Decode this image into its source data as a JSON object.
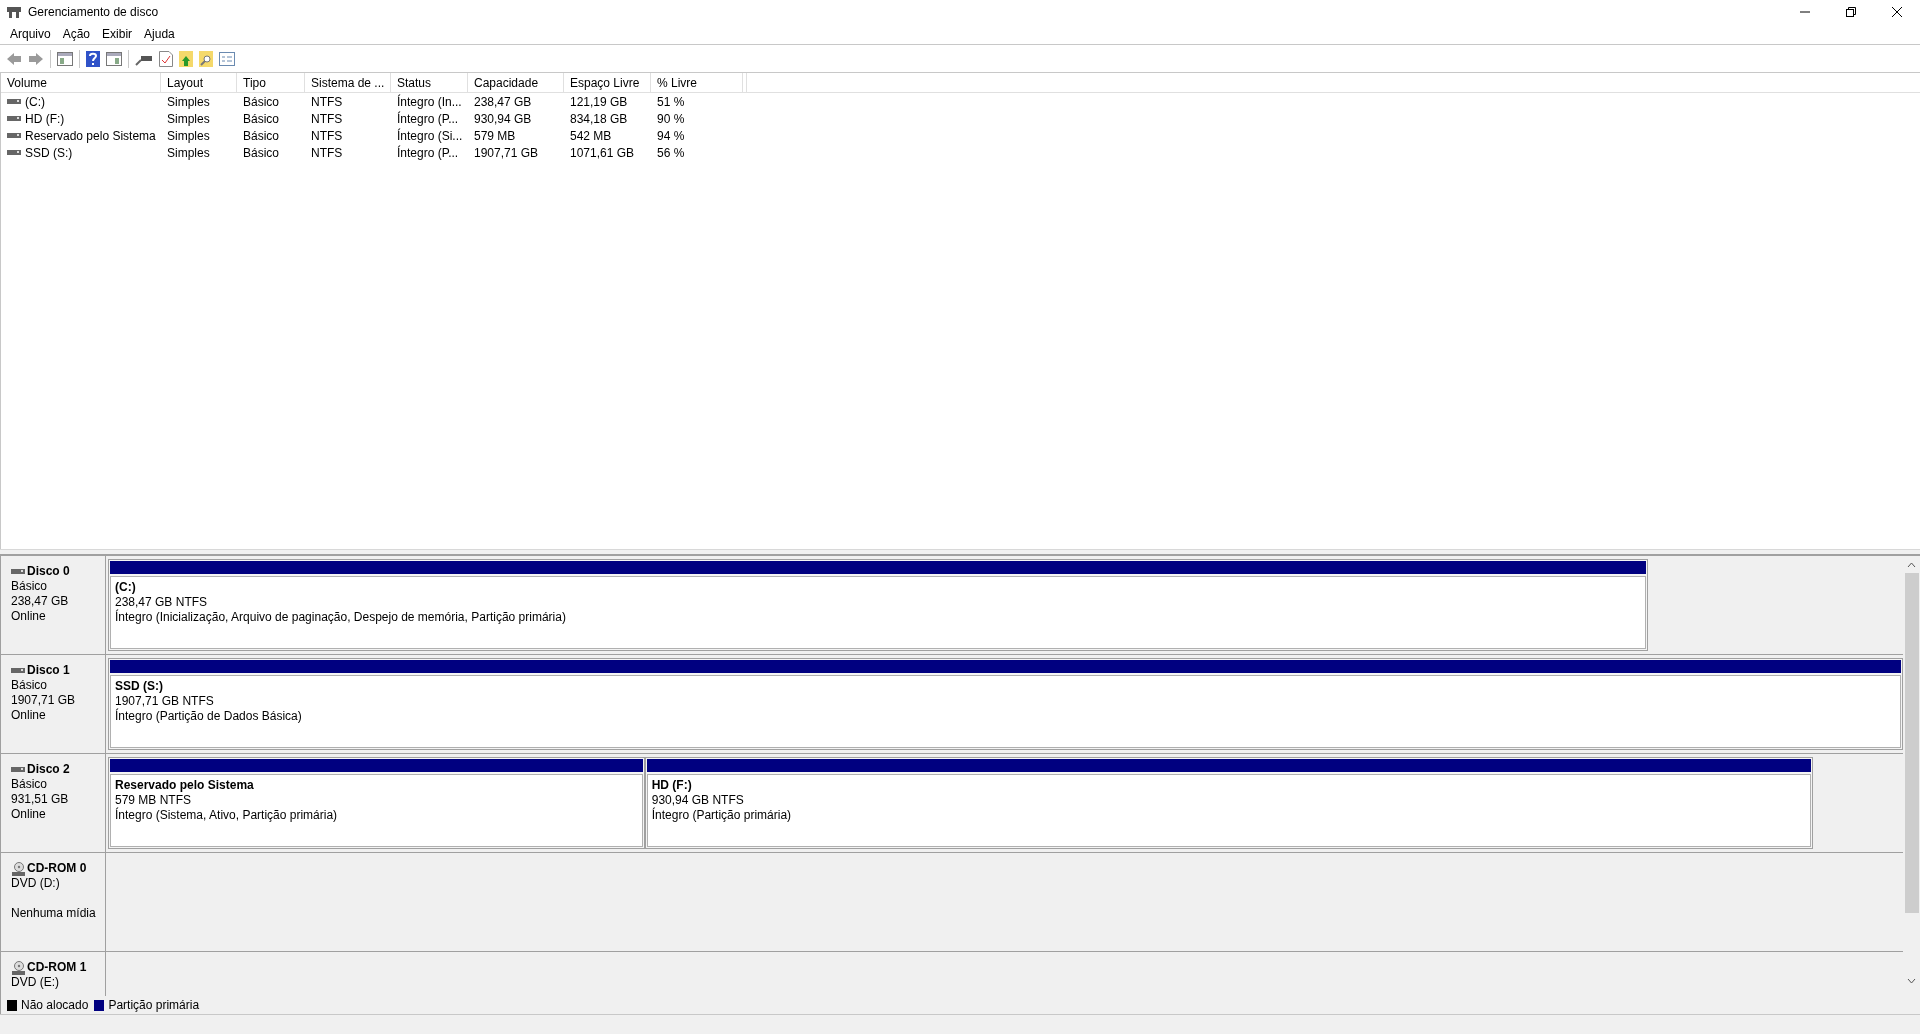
{
  "window": {
    "title": "Gerenciamento de disco"
  },
  "menu": [
    "Arquivo",
    "Ação",
    "Exibir",
    "Ajuda"
  ],
  "table": {
    "columns": [
      "Volume",
      "Layout",
      "Tipo",
      "Sistema de ...",
      "Status",
      "Capacidade",
      "Espaço Livre",
      "% Livre"
    ],
    "rows": [
      [
        "(C:)",
        "Simples",
        "Básico",
        "NTFS",
        "Íntegro (In...",
        "238,47 GB",
        "121,19 GB",
        "51 %"
      ],
      [
        "HD (F:)",
        "Simples",
        "Básico",
        "NTFS",
        "Íntegro (P...",
        "930,94 GB",
        "834,18 GB",
        "90 %"
      ],
      [
        "Reservado pelo Sistema",
        "Simples",
        "Básico",
        "NTFS",
        "Íntegro (Si...",
        "579 MB",
        "542 MB",
        "94 %"
      ],
      [
        "SSD (S:)",
        "Simples",
        "Básico",
        "NTFS",
        "Íntegro (P...",
        "1907,71 GB",
        "1071,61 GB",
        "56 %"
      ]
    ]
  },
  "disks": [
    {
      "kind": "disk",
      "name": "Disco 0",
      "lines": [
        "Básico",
        "238,47 GB",
        "Online"
      ],
      "partitions": [
        {
          "title": "(C:)",
          "size": "238,47 GB NTFS",
          "status": "Íntegro (Inicialização, Arquivo de paginação, Despejo de memória, Partição primária)"
        }
      ]
    },
    {
      "kind": "disk",
      "name": "Disco 1",
      "lines": [
        "Básico",
        "1907,71 GB",
        "Online"
      ],
      "partitions": [
        {
          "title": "SSD  (S:)",
          "size": "1907,71 GB NTFS",
          "status": "Íntegro (Partição de Dados Básica)"
        }
      ]
    },
    {
      "kind": "disk",
      "name": "Disco 2",
      "lines": [
        "Básico",
        "931,51 GB",
        "Online"
      ],
      "partitions": [
        {
          "title": "Reservado pelo Sistema",
          "size": "579 MB NTFS",
          "status": "Íntegro (Sistema, Ativo, Partição primária)"
        },
        {
          "title": "HD  (F:)",
          "size": "930,94 GB NTFS",
          "status": "Íntegro (Partição primária)"
        }
      ]
    },
    {
      "kind": "cdrom",
      "name": "CD-ROM 0",
      "drive": "DVD (D:)",
      "media": "Nenhuma mídia"
    },
    {
      "kind": "cdrom",
      "name": "CD-ROM 1",
      "drive": "DVD (E:)"
    }
  ],
  "legend": [
    {
      "label": "Não alocado",
      "color": "#000000"
    },
    {
      "label": "Partição primária",
      "color": "#000080"
    }
  ]
}
